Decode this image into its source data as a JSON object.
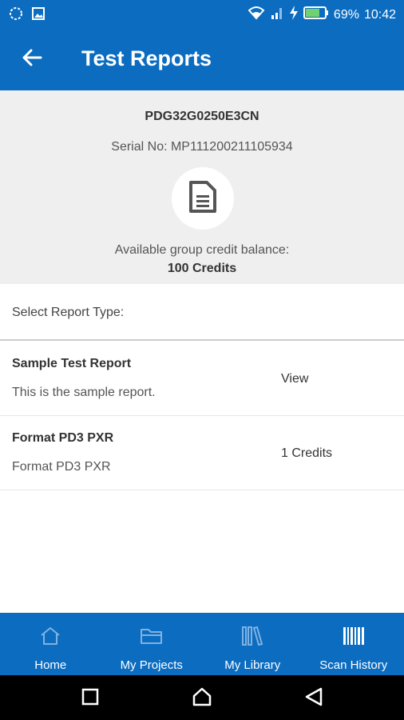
{
  "status_bar": {
    "battery": "69%",
    "time": "10:42",
    "icons": [
      "circle-notification-icon",
      "image-notification-icon",
      "wifi-icon",
      "signal-icon",
      "charging-icon",
      "battery-icon"
    ]
  },
  "header": {
    "title": "Test Reports",
    "back_icon": "arrow-left-icon"
  },
  "device": {
    "model": "PDG32G0250E3CN",
    "serial": "Serial No: MP111200211105934",
    "icon": "document-icon",
    "credit_label": "Available group credit balance:",
    "credit_value": "100  Credits"
  },
  "select_label": "Select Report Type:",
  "reports": [
    {
      "title": "Sample Test Report",
      "description": "This is the sample report.",
      "action": "View"
    },
    {
      "title": "Format PD3 PXR",
      "description": "Format PD3 PXR",
      "action": "1 Credits"
    }
  ],
  "bottom_nav": [
    {
      "label": "Home",
      "icon": "home-icon"
    },
    {
      "label": "My Projects",
      "icon": "folder-icon"
    },
    {
      "label": "My Library",
      "icon": "library-icon"
    },
    {
      "label": "Scan History",
      "icon": "barcode-icon"
    }
  ],
  "colors": {
    "primary": "#0b6cc0",
    "panel_bg": "#efefef"
  }
}
